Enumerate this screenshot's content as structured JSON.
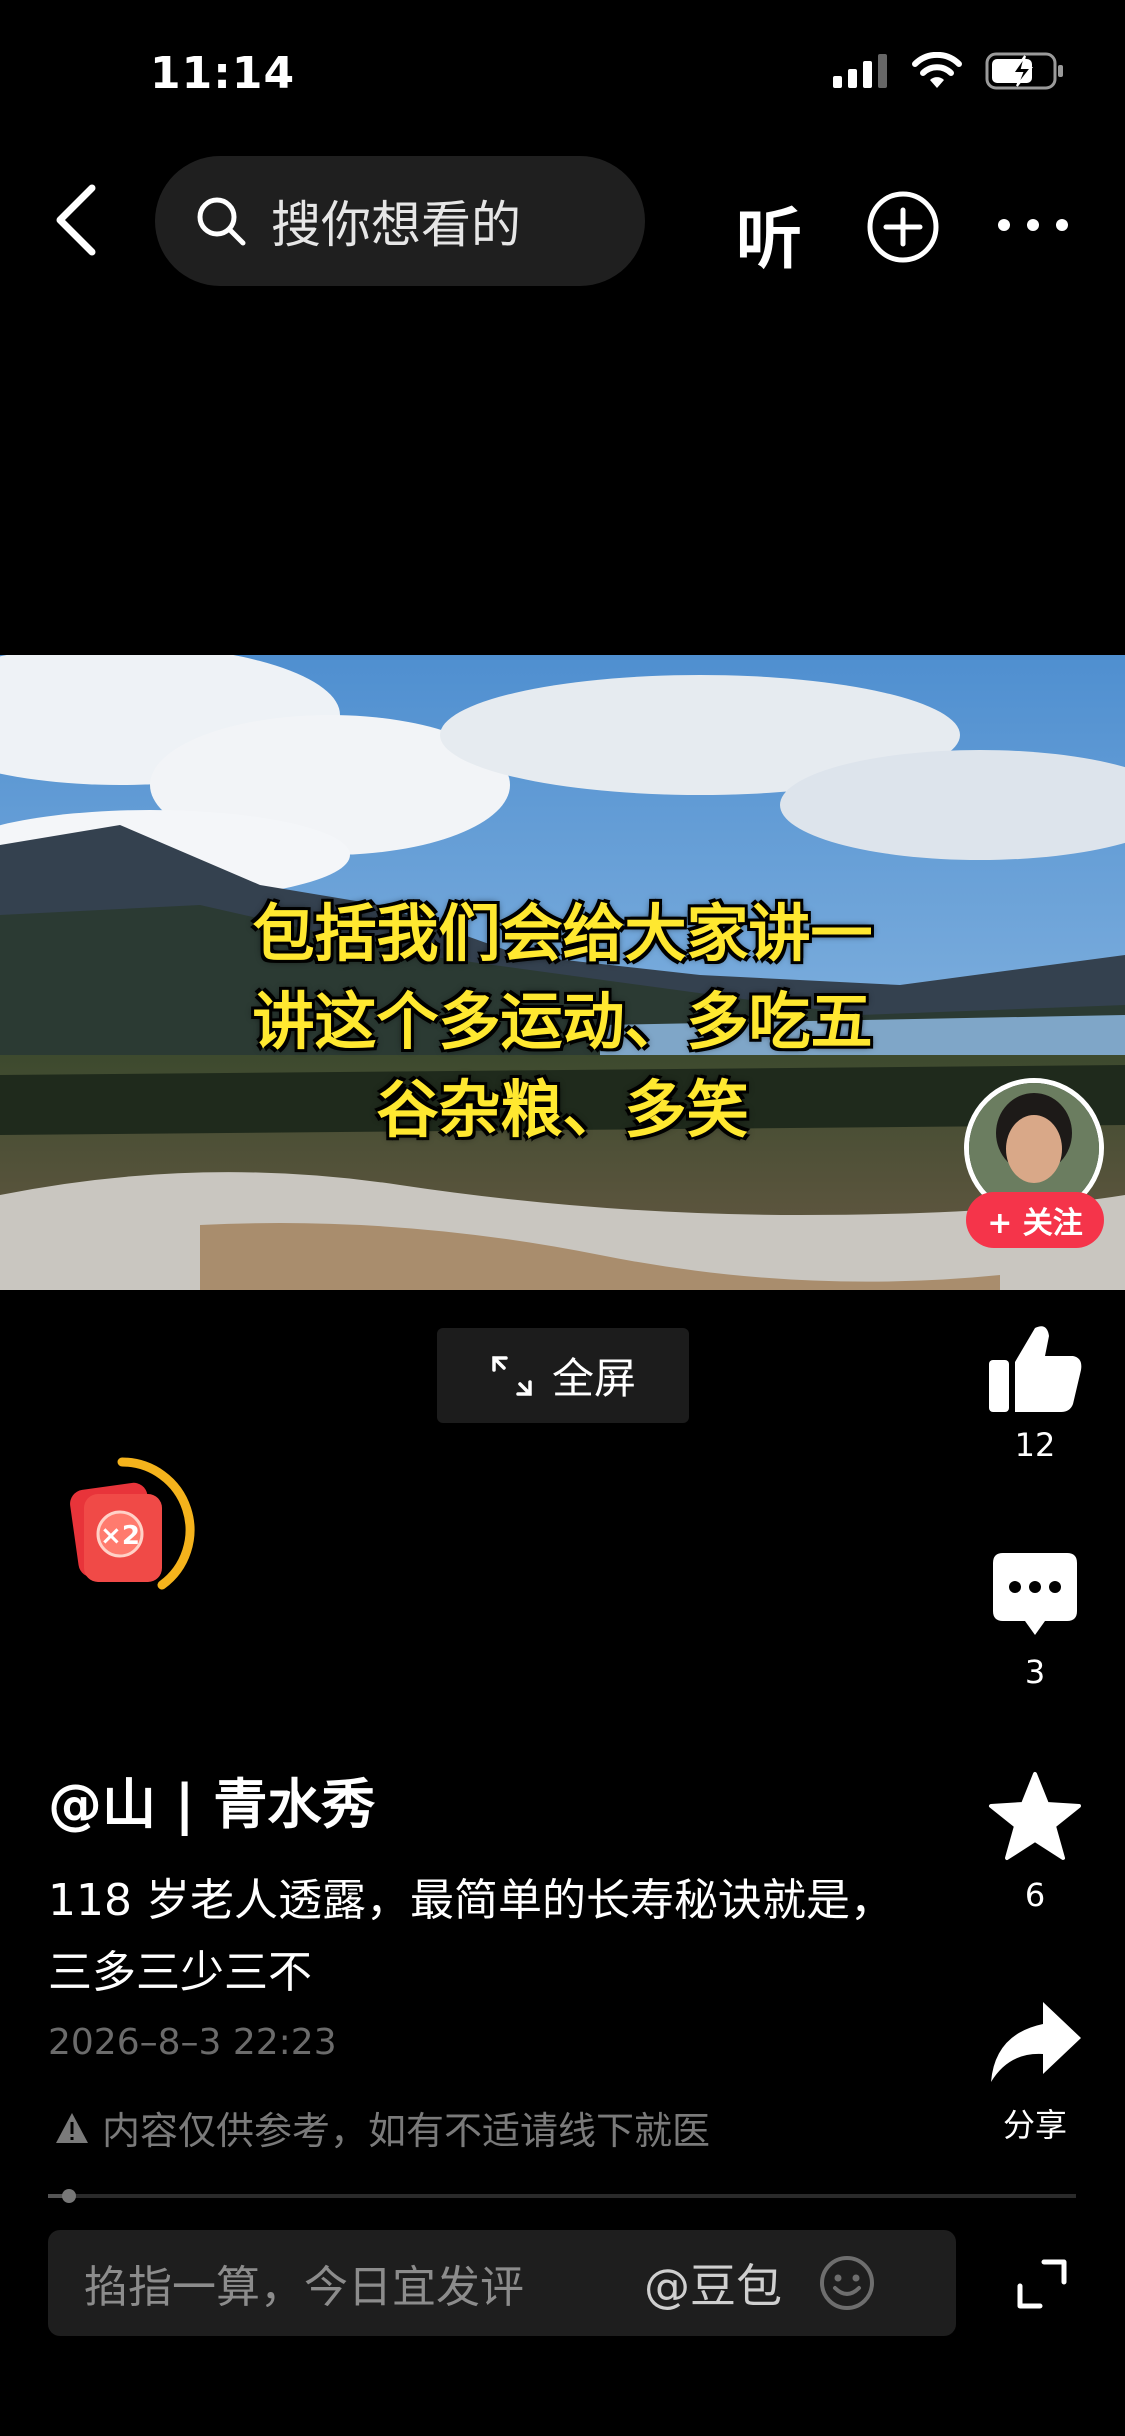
{
  "status_bar": {
    "time": "11:14"
  },
  "nav": {
    "search_placeholder": "搜你想看的",
    "listen_label": "听"
  },
  "video": {
    "caption_lines": [
      "包括我们会给大家讲一",
      "讲这个多运动、多吃五",
      "谷杂粮、多笑"
    ],
    "follow_label": "+ 关注",
    "fullscreen_label": "全屏"
  },
  "red_packet": {
    "badge": "×2"
  },
  "actions": {
    "like_count": "12",
    "comment_count": "3",
    "favorite_count": "6",
    "share_label": "分享"
  },
  "post": {
    "author": "@山 | 青水秀",
    "title": "118 岁老人透露，最简单的长寿秘诀就是，三多三少三不",
    "date": "2026–8–3 22:23",
    "notice": "内容仅供参考，如有不适请线下就医",
    "progress": 0.02
  },
  "comment_bar": {
    "placeholder": "掐指一算，今日宜发评",
    "mention": "@豆包"
  },
  "colors": {
    "accent_red": "#f5344a",
    "caption_yellow": "#ffe830"
  }
}
